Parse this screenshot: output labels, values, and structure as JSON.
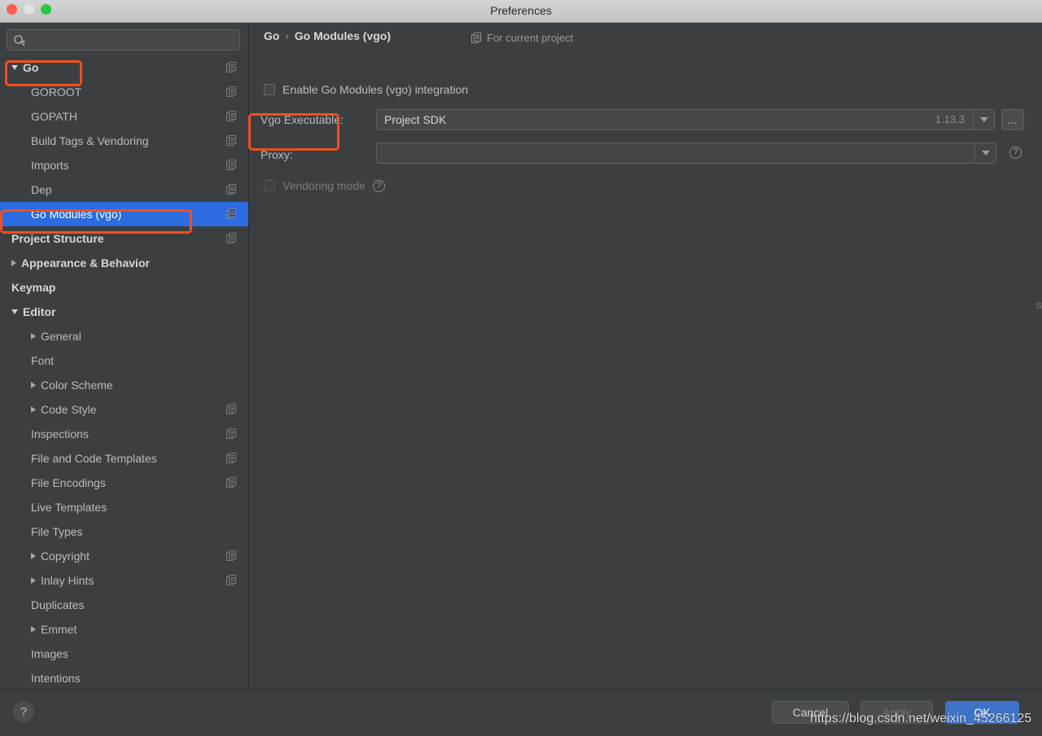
{
  "window": {
    "title": "Preferences",
    "traffic_lights": [
      "close-red",
      "minimize-gray",
      "zoom-green"
    ]
  },
  "sidebar": {
    "search": {
      "value": "",
      "placeholder": "",
      "icon": "search-icon"
    },
    "items": [
      {
        "label": "Go",
        "indent": 0,
        "arrow": "down",
        "bold": true,
        "copy": true,
        "selected": false
      },
      {
        "label": "GOROOT",
        "indent": 1,
        "arrow": "none",
        "bold": false,
        "copy": true,
        "selected": false
      },
      {
        "label": "GOPATH",
        "indent": 1,
        "arrow": "none",
        "bold": false,
        "copy": true,
        "selected": false
      },
      {
        "label": "Build Tags & Vendoring",
        "indent": 1,
        "arrow": "none",
        "bold": false,
        "copy": true,
        "selected": false
      },
      {
        "label": "Imports",
        "indent": 1,
        "arrow": "none",
        "bold": false,
        "copy": true,
        "selected": false
      },
      {
        "label": "Dep",
        "indent": 1,
        "arrow": "none",
        "bold": false,
        "copy": true,
        "selected": false
      },
      {
        "label": "Go Modules (vgo)",
        "indent": 1,
        "arrow": "none",
        "bold": false,
        "copy": true,
        "selected": true
      },
      {
        "label": "Project Structure",
        "indent": 0,
        "arrow": "none",
        "bold": true,
        "copy": true,
        "selected": false
      },
      {
        "label": "Appearance & Behavior",
        "indent": 0,
        "arrow": "right",
        "bold": true,
        "copy": false,
        "selected": false
      },
      {
        "label": "Keymap",
        "indent": 0,
        "arrow": "none",
        "bold": true,
        "copy": false,
        "selected": false
      },
      {
        "label": "Editor",
        "indent": 0,
        "arrow": "down",
        "bold": true,
        "copy": false,
        "selected": false
      },
      {
        "label": "General",
        "indent": 1,
        "arrow": "right",
        "bold": false,
        "copy": false,
        "selected": false
      },
      {
        "label": "Font",
        "indent": 1,
        "arrow": "none",
        "bold": false,
        "copy": false,
        "selected": false
      },
      {
        "label": "Color Scheme",
        "indent": 1,
        "arrow": "right",
        "bold": false,
        "copy": false,
        "selected": false
      },
      {
        "label": "Code Style",
        "indent": 1,
        "arrow": "right",
        "bold": false,
        "copy": true,
        "selected": false
      },
      {
        "label": "Inspections",
        "indent": 1,
        "arrow": "none",
        "bold": false,
        "copy": true,
        "selected": false
      },
      {
        "label": "File and Code Templates",
        "indent": 1,
        "arrow": "none",
        "bold": false,
        "copy": true,
        "selected": false
      },
      {
        "label": "File Encodings",
        "indent": 1,
        "arrow": "none",
        "bold": false,
        "copy": true,
        "selected": false
      },
      {
        "label": "Live Templates",
        "indent": 1,
        "arrow": "none",
        "bold": false,
        "copy": false,
        "selected": false
      },
      {
        "label": "File Types",
        "indent": 1,
        "arrow": "none",
        "bold": false,
        "copy": false,
        "selected": false
      },
      {
        "label": "Copyright",
        "indent": 1,
        "arrow": "right",
        "bold": false,
        "copy": true,
        "selected": false
      },
      {
        "label": "Inlay Hints",
        "indent": 1,
        "arrow": "right",
        "bold": false,
        "copy": true,
        "selected": false
      },
      {
        "label": "Duplicates",
        "indent": 1,
        "arrow": "none",
        "bold": false,
        "copy": false,
        "selected": false
      },
      {
        "label": "Emmet",
        "indent": 1,
        "arrow": "right",
        "bold": false,
        "copy": false,
        "selected": false
      },
      {
        "label": "Images",
        "indent": 1,
        "arrow": "none",
        "bold": false,
        "copy": false,
        "selected": false
      },
      {
        "label": "Intentions",
        "indent": 1,
        "arrow": "none",
        "bold": false,
        "copy": false,
        "selected": false
      }
    ]
  },
  "main": {
    "breadcrumb": {
      "root": "Go",
      "separator": "›",
      "leaf": "Go Modules (vgo)"
    },
    "for_current_project": "For current project",
    "enable_checkbox": {
      "label": "Enable Go Modules (vgo) integration",
      "checked": false
    },
    "vgo_executable": {
      "label": "Vgo Executable:",
      "value": "Project SDK",
      "version": "1.13.3",
      "browse": "…"
    },
    "proxy": {
      "label": "Proxy:",
      "value": "",
      "help": "?"
    },
    "vendoring": {
      "label": "Vendoring mode",
      "checked": false,
      "disabled": true,
      "help": "?"
    }
  },
  "footer": {
    "help": "?",
    "cancel": "Cancel",
    "apply": "Apply",
    "ok": "OK"
  },
  "overlay": {
    "watermark": "https://blog.csdn.net/weixin_45266125",
    "annotation_color": "#f24e1e",
    "edge_glyph": "S"
  }
}
